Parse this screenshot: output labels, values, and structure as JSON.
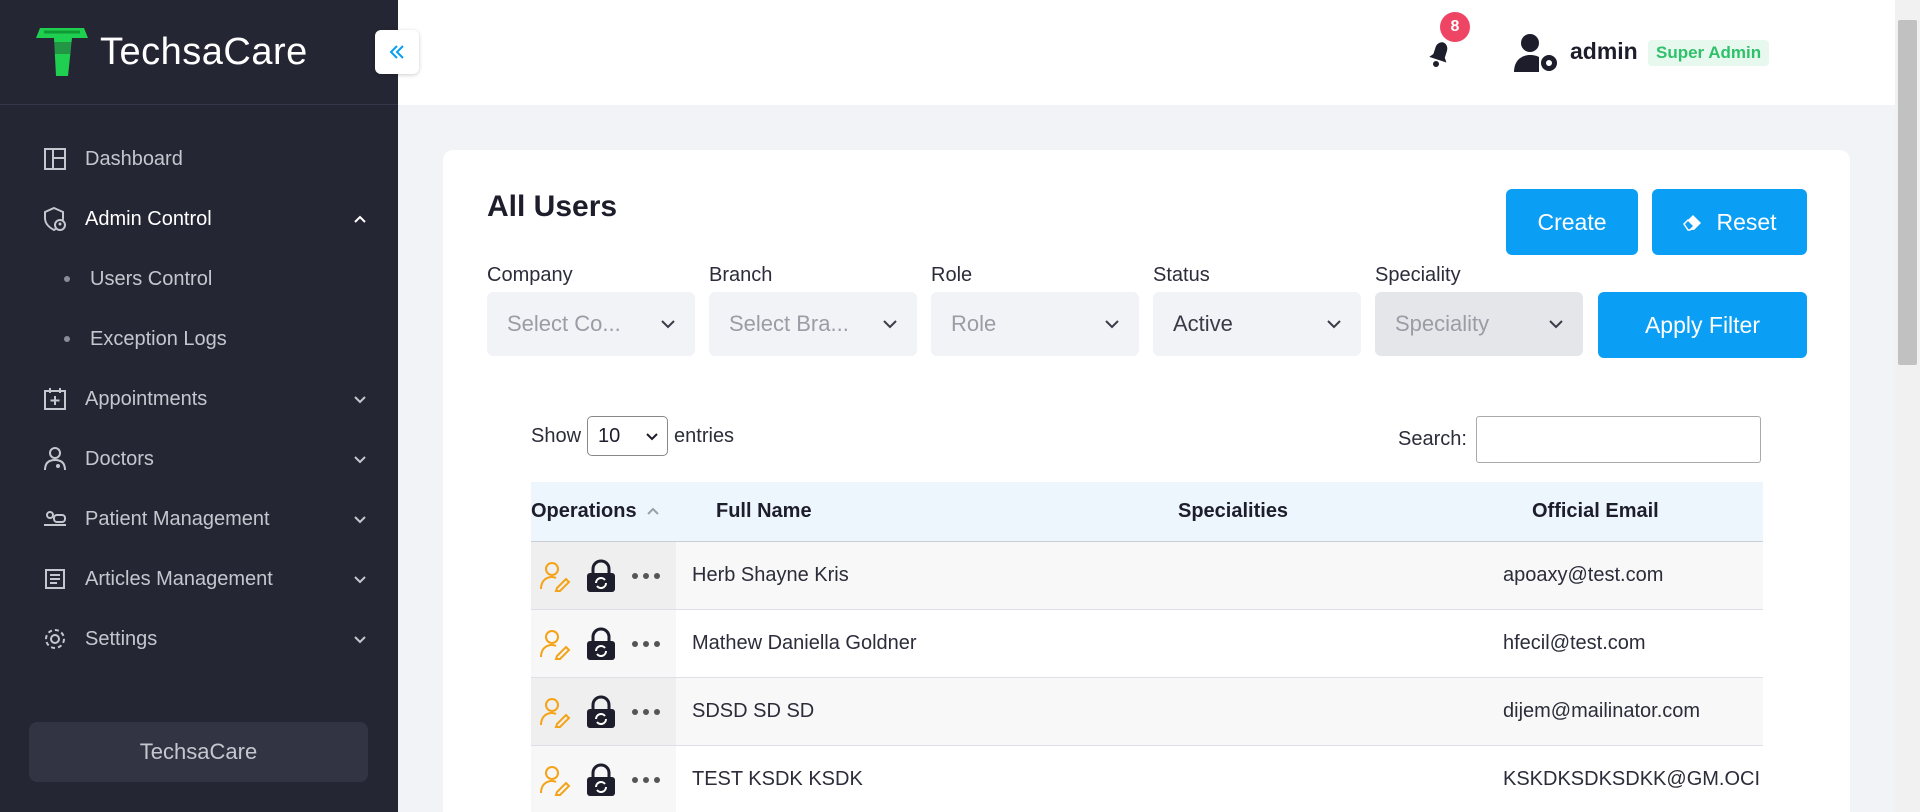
{
  "brand": {
    "name": "TechsaCare",
    "accent": "#0a9ef5",
    "logo_color": "#1fcf4f"
  },
  "sidebar": {
    "items": [
      {
        "label": "Dashboard",
        "icon": "layout-icon"
      },
      {
        "label": "Admin Control",
        "icon": "shield-user-icon",
        "expanded": true,
        "children": [
          {
            "label": "Users Control"
          },
          {
            "label": "Exception Logs"
          }
        ]
      },
      {
        "label": "Appointments",
        "icon": "calendar-plus-icon"
      },
      {
        "label": "Doctors",
        "icon": "doctor-icon"
      },
      {
        "label": "Patient Management",
        "icon": "patient-icon"
      },
      {
        "label": "Articles Management",
        "icon": "articles-icon"
      },
      {
        "label": "Settings",
        "icon": "gear-icon"
      }
    ],
    "footer": "TechsaCare"
  },
  "header": {
    "notifications_count": "8",
    "user_name": "admin",
    "user_role": "Super Admin"
  },
  "main": {
    "title": "All Users",
    "buttons": {
      "create": "Create",
      "reset": "Reset",
      "apply": "Apply Filter"
    },
    "filters": [
      {
        "label": "Company",
        "value": "Select Co...",
        "placeholder": true
      },
      {
        "label": "Branch",
        "value": "Select Bra...",
        "placeholder": true
      },
      {
        "label": "Role",
        "value": "Role",
        "placeholder": true
      },
      {
        "label": "Status",
        "value": "Active",
        "placeholder": false
      },
      {
        "label": "Speciality",
        "value": "Speciality",
        "placeholder": true,
        "disabled": true
      }
    ],
    "datatable": {
      "show_label": "Show",
      "entries_value": "10",
      "entries_label": "entries",
      "search_label": "Search:",
      "search_value": ""
    },
    "table": {
      "columns": [
        "Operations",
        "Full Name",
        "Specialities",
        "Official Email"
      ],
      "rows": [
        {
          "name": "Herb Shayne Kris",
          "specialities": "",
          "email": "apoaxy@test.com"
        },
        {
          "name": "Mathew Daniella Goldner",
          "specialities": "",
          "email": "hfecil@test.com"
        },
        {
          "name": "SDSD SD SD",
          "specialities": "",
          "email": "dijem@mailinator.com"
        },
        {
          "name": "TEST KSDK KSDK",
          "specialities": "",
          "email": "KSKDKSDKSDKK@GM.OCI"
        }
      ]
    }
  }
}
